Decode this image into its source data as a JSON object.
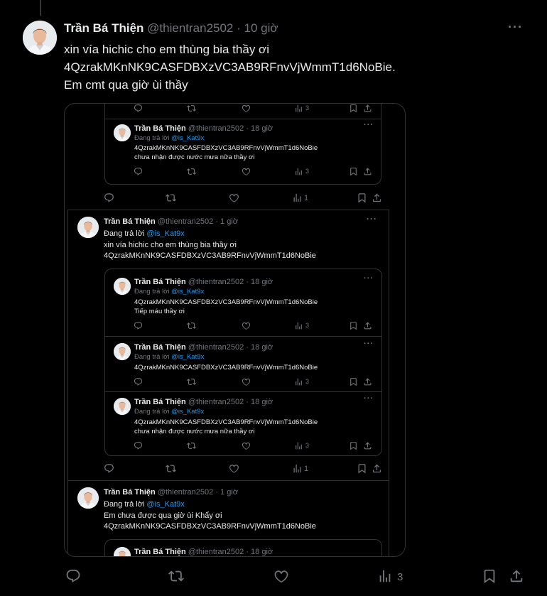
{
  "post": {
    "author": "Trần Bá Thiện",
    "handle": "@thientran2502",
    "time": "· 10 giờ",
    "more": "···",
    "lines": [
      "xin vía hichic cho em thùng bia thầy ơi",
      "4QzrakMKnNK9CASFDBXzVC3AB9RFnvVjWmmT1d6NoBie.",
      "Em cmt qua giờ ùi thầy"
    ],
    "views": "3"
  },
  "screenshot": {
    "q_top_views": "3",
    "c1": {
      "author": "Trần Bá Thiện",
      "handle": "@thientran2502 · 18 giờ",
      "reply_prefix": "Đang trả lời",
      "reply_to": "@is_Kat9x",
      "line1": "4QzrakMKnNK9CASFDBXzVC3AB9RFnvVjWmmT1d6NoBie",
      "line2": "chưa nhận được nước mưa nữa thầy ơi",
      "views": "3"
    },
    "row1_views": "1",
    "r2": {
      "author": "Trần Bá Thiện",
      "handle": "@thientran2502 · 1 giờ",
      "reply_prefix": "Đang trả lời",
      "reply_to": "@is_Kat9x",
      "line1": "xin vía hichic cho em thùng bia thầy ơi",
      "line2": "4QzrakMKnNK9CASFDBXzVC3AB9RFnvVjWmmT1d6NoBie"
    },
    "q1": {
      "author": "Trần Bá Thiện",
      "handle": "@thientran2502 · 18 giờ",
      "reply_prefix": "Đang trả lời",
      "reply_to": "@is_Kat9x",
      "line1": "4QzrakMKnNK9CASFDBXzVC3AB9RFnvVjWmmT1d6NoBie",
      "line2": "Tiếp máu thầy ơi",
      "views": "3"
    },
    "q2": {
      "author": "Trần Bá Thiện",
      "handle": "@thientran2502 · 18 giờ",
      "reply_prefix": "Đang trả lời",
      "reply_to": "@is_Kat9x",
      "line1": "4QzrakMKnNK9CASFDBXzVC3AB9RFnvVjWmmT1d6NoBie",
      "views": "3"
    },
    "q3": {
      "author": "Trần Bá Thiện",
      "handle": "@thientran2502 · 18 giờ",
      "reply_prefix": "Đang trả lời",
      "reply_to": "@is_Kat9x",
      "line1": "4QzrakMKnNK9CASFDBXzVC3AB9RFnvVjWmmT1d6NoBie",
      "line2": "chưa nhận được nước mưa nữa thầy ơi",
      "views": "3"
    },
    "row2_views": "1",
    "r3": {
      "author": "Trần Bá Thiện",
      "handle": "@thientran2502 · 1 giờ",
      "reply_prefix": "Đang trả lời",
      "reply_to": "@is_Kat9x",
      "line1": "Em chưa được qua giờ ùi Khẩy ơi",
      "line2": "4QzrakMKnNK9CASFDBXzVC3AB9RFnvVjWmmT1d6NoBie"
    },
    "q4": {
      "author": "Trần Bá Thiện",
      "handle": "@thientran2502 · 18 giờ"
    }
  },
  "icons": {
    "reply": "reply-icon",
    "repost": "repost-icon",
    "like": "like-icon",
    "views": "views-icon",
    "bookmark": "bookmark-icon",
    "share": "share-icon",
    "more": "more-icon"
  },
  "colors": {
    "background": "#000000",
    "text": "#e7e9ea",
    "muted": "#71767b",
    "link": "#1d9bf0",
    "border": "#2f3336"
  }
}
